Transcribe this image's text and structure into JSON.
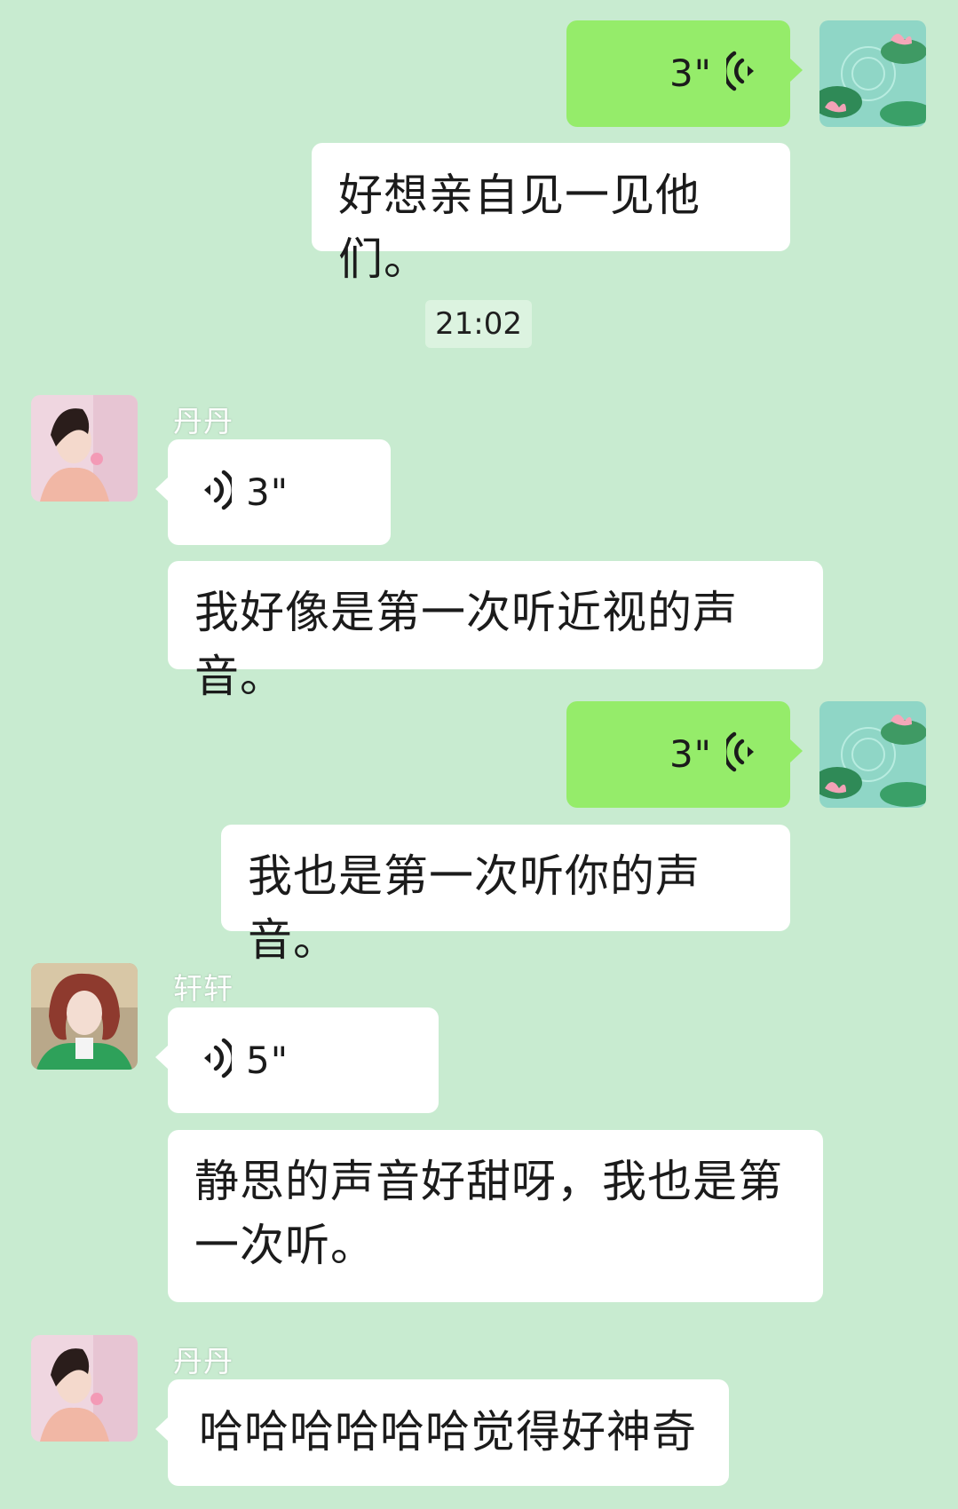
{
  "colors": {
    "background": "#c8ebd0",
    "bubble_self": "#95ec6a",
    "bubble_other": "#ffffff",
    "timestamp_bg": "#dcf3e0"
  },
  "messages": {
    "m1": {
      "type": "voice",
      "sender": "self",
      "duration": "3\"",
      "icon": "voice-wave-icon"
    },
    "m2": {
      "type": "text",
      "sender": "self",
      "text": "好想亲自见一见他们。"
    },
    "time1": {
      "text": "21:02"
    },
    "m3": {
      "type": "voice",
      "sender_name": "丹丹",
      "duration": "3\"",
      "icon": "voice-wave-icon"
    },
    "m4": {
      "type": "text",
      "sender_name": "丹丹",
      "text": "我好像是第一次听近视的声音。"
    },
    "m5": {
      "type": "voice",
      "sender": "self",
      "duration": "3\"",
      "icon": "voice-wave-icon"
    },
    "m6": {
      "type": "text",
      "sender": "self",
      "text": "我也是第一次听你的声音。"
    },
    "m7": {
      "type": "voice",
      "sender_name": "轩轩",
      "duration": "5\"",
      "icon": "voice-wave-icon"
    },
    "m8": {
      "type": "text",
      "sender_name": "轩轩",
      "text": "静思的声音好甜呀，我也是第一次听。"
    },
    "m9": {
      "type": "text",
      "sender_name": "丹丹",
      "text": "哈哈哈哈哈哈觉得好神奇"
    }
  }
}
